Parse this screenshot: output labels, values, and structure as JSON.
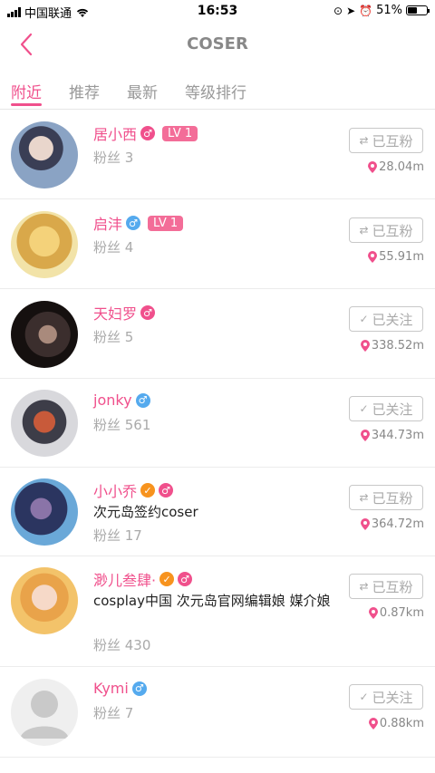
{
  "status": {
    "carrier": "中国联通",
    "time": "16:53",
    "battery": "51%",
    "battery_level": 0.51
  },
  "nav": {
    "title": "COSER"
  },
  "tabs": [
    {
      "label": "附近",
      "active": true
    },
    {
      "label": "推荐",
      "active": false
    },
    {
      "label": "最新",
      "active": false
    },
    {
      "label": "等级排行",
      "active": false
    }
  ],
  "users": [
    {
      "name": "居小西",
      "gender": "female",
      "level": "LV 1",
      "fans": "粉丝 3",
      "follow": "已互粉",
      "follow_icon": "swap-icon",
      "distance": "28.04m"
    },
    {
      "name": "启沣",
      "gender": "male",
      "level": "LV 1",
      "fans": "粉丝 4",
      "follow": "已互粉",
      "follow_icon": "swap-icon",
      "distance": "55.91m"
    },
    {
      "name": "天妇罗",
      "gender": "female",
      "fans": "粉丝 5",
      "follow": "已关注",
      "follow_icon": "check-icon",
      "distance": "338.52m"
    },
    {
      "name": "jonky",
      "gender": "male",
      "fans": "粉丝 561",
      "follow": "已关注",
      "follow_icon": "check-icon",
      "distance": "344.73m"
    },
    {
      "name": "小小乔",
      "gender": "female",
      "verified": true,
      "desc": "次元岛签约coser",
      "fans": "粉丝 17",
      "follow": "已互粉",
      "follow_icon": "swap-icon",
      "distance": "364.72m"
    },
    {
      "name": "渺儿叁肆·",
      "gender": "female",
      "verified": true,
      "desc": "cosplay中国 次元岛官网编辑娘 媒介娘",
      "fans": "粉丝 430",
      "follow": "已互粉",
      "follow_icon": "swap-icon",
      "distance": "0.87km"
    },
    {
      "name": "Kymi",
      "gender": "male",
      "fans": "粉丝 7",
      "follow": "已关注",
      "follow_icon": "check-icon",
      "distance": "0.88km"
    }
  ],
  "colors": {
    "accent": "#f0508c",
    "male": "#55aaee",
    "verified": "#f7931e"
  }
}
